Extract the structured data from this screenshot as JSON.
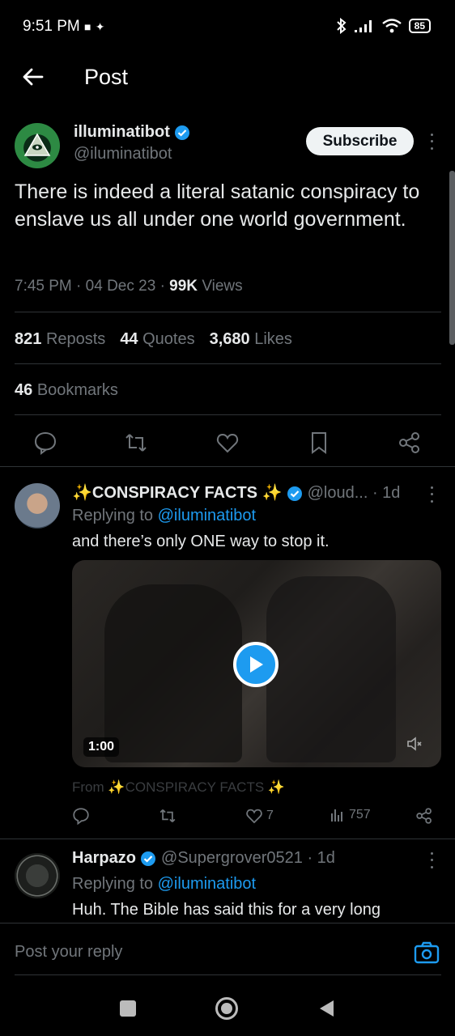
{
  "status_bar": {
    "time": "9:51 PM",
    "battery": "85"
  },
  "header": {
    "title": "Post"
  },
  "post": {
    "display_name": "illuminatibot",
    "handle": "@iluminatibot",
    "subscribe_label": "Subscribe",
    "text": "There is indeed a literal satanic conspiracy to enslave us all under one world government.",
    "time": "7:45 PM",
    "date": "04 Dec 23",
    "views_count": "99K",
    "views_label": "Views",
    "reposts_count": "821",
    "reposts_label": "Reposts",
    "quotes_count": "44",
    "quotes_label": "Quotes",
    "likes_count": "3,680",
    "likes_label": "Likes",
    "bookmarks_count": "46",
    "bookmarks_label": "Bookmarks"
  },
  "replies": [
    {
      "display_name": "✨CONSPIRACY FACTS ✨",
      "handle": "@loud...",
      "age": "· 1d",
      "replying_label": "Replying to",
      "replying_to": "@iluminatibot",
      "text": "and there’s only ONE way to stop it.",
      "video_duration": "1:00",
      "from_label": "From",
      "from_source": "✨CONSPIRACY FACTS ✨",
      "likes": "7",
      "views": "757"
    },
    {
      "display_name": "Harpazo",
      "handle": "@Supergrover0521",
      "age": "· 1d",
      "replying_label": "Replying to",
      "replying_to": "@iluminatibot",
      "text": "Huh. The Bible has said this for a very long"
    }
  ],
  "reply_box": {
    "placeholder": "Post your reply"
  },
  "colors": {
    "accent": "#1d9bf0",
    "text": "#e7e9ea",
    "muted": "#71767b",
    "divider": "#2f3336"
  }
}
